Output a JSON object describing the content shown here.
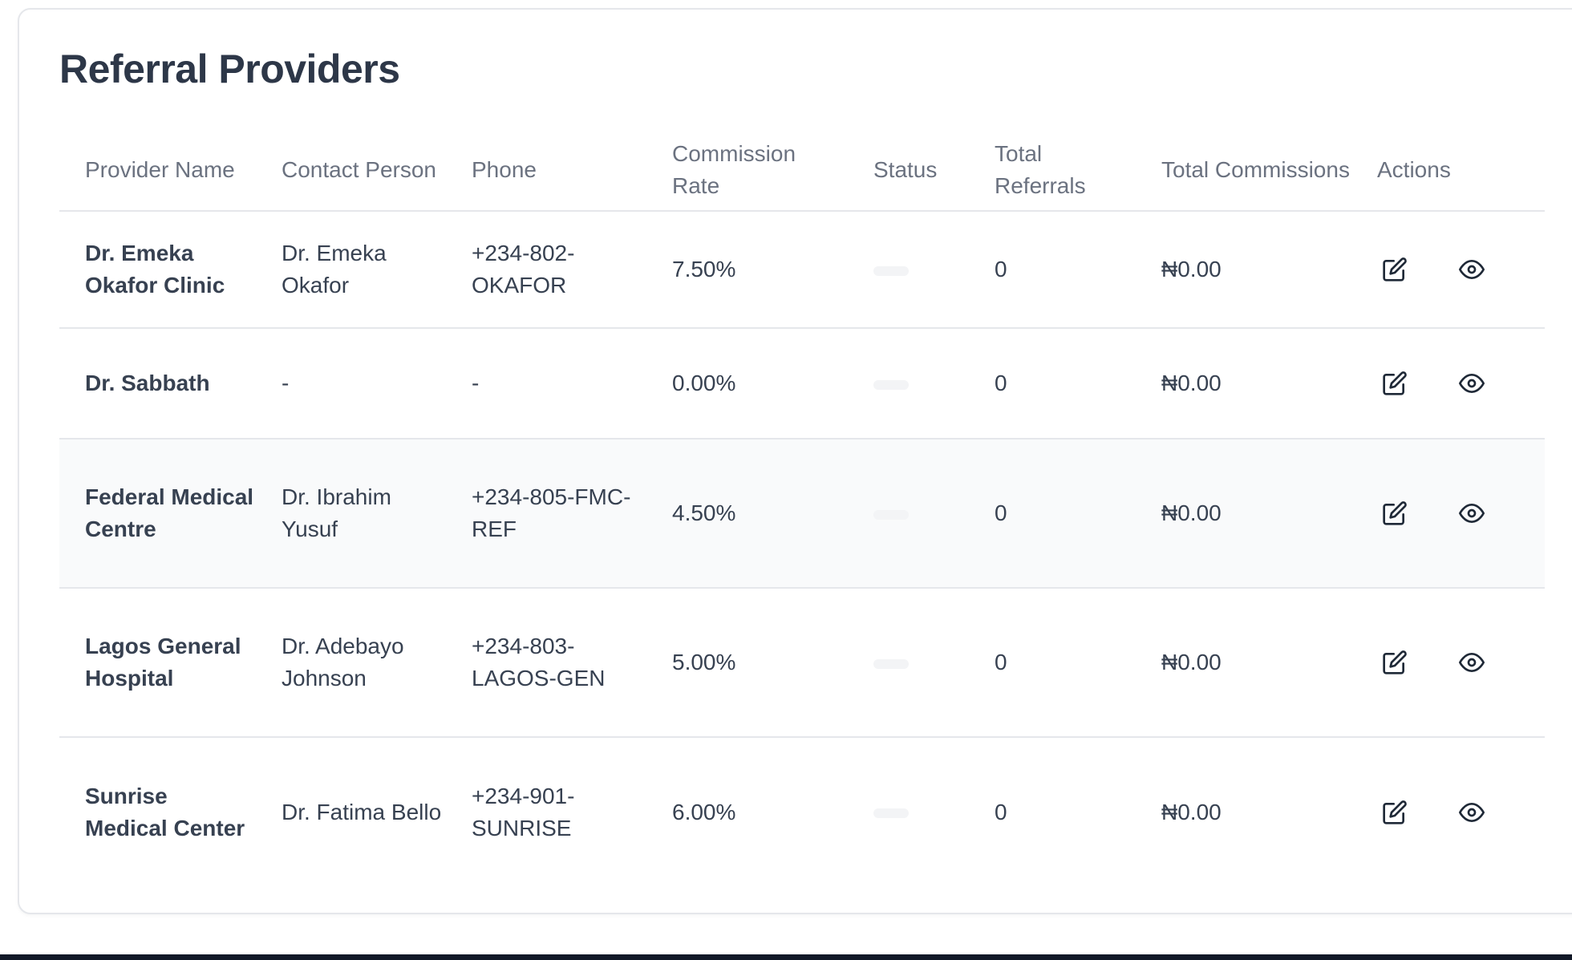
{
  "page": {
    "title": "Referral Providers"
  },
  "table": {
    "headers": {
      "provider_name": "Provider Name",
      "contact_person": "Contact Person",
      "phone": "Phone",
      "commission_rate": "Commission Rate",
      "status": "Status",
      "total_referrals": "Total Referrals",
      "total_commissions": "Total Commissions",
      "actions": "Actions"
    },
    "rows": [
      {
        "provider_name": "Dr. Emeka Okafor Clinic",
        "contact_person": "Dr. Emeka Okafor",
        "phone": "+234-802-OKAFOR",
        "commission_rate": "7.50%",
        "total_referrals": "0",
        "total_commissions": "₦0.00"
      },
      {
        "provider_name": "Dr. Sabbath",
        "contact_person": "-",
        "phone": "-",
        "commission_rate": "0.00%",
        "total_referrals": "0",
        "total_commissions": "₦0.00"
      },
      {
        "provider_name": "Federal Medical Centre",
        "contact_person": "Dr. Ibrahim Yusuf",
        "phone": "+234-805-FMC-REF",
        "commission_rate": "4.50%",
        "total_referrals": "0",
        "total_commissions": "₦0.00"
      },
      {
        "provider_name": "Lagos General Hospital",
        "contact_person": "Dr. Adebayo Johnson",
        "phone": "+234-803-LAGOS-GEN",
        "commission_rate": "5.00%",
        "total_referrals": "0",
        "total_commissions": "₦0.00"
      },
      {
        "provider_name": "Sunrise Medical Center",
        "contact_person": "Dr. Fatima Bello",
        "phone": "+234-901-SUNRISE",
        "commission_rate": "6.00%",
        "total_referrals": "0",
        "total_commissions": "₦0.00"
      }
    ],
    "row_actions": [
      "edit-icon",
      "eye-icon"
    ],
    "highlighted_row": 2
  },
  "colors": {
    "title": "#2d3748",
    "header_text": "#6b7280",
    "row_highlight": "#f9fafb",
    "border": "#e5e7eb"
  }
}
